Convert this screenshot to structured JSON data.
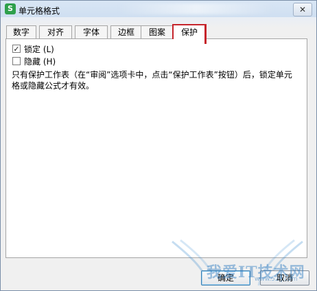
{
  "window": {
    "title": "单元格格式",
    "app_icon_letter": "S",
    "close_glyph": "✕"
  },
  "tabs": [
    {
      "label": "数字",
      "active": false
    },
    {
      "label": "对齐",
      "active": false
    },
    {
      "label": "字体",
      "active": false
    },
    {
      "label": "边框",
      "active": false
    },
    {
      "label": "图案",
      "active": false
    },
    {
      "label": "保护",
      "active": true
    }
  ],
  "protection": {
    "locked": {
      "label": "锁定 (L)",
      "checked": true
    },
    "hidden": {
      "label": "隐藏 (H)",
      "checked": false
    },
    "description": "只有保护工作表（在“审阅”选项卡中，点击“保护工作表”按钮）后，锁定单元格或隐藏公式才有效。"
  },
  "buttons": {
    "ok": "确定",
    "cancel": "取消"
  },
  "watermark": {
    "text": "我爱IT技术网",
    "url": "www.52ij.com"
  },
  "colors": {
    "highlight": "#c6242b",
    "app_icon": "#2ea04c"
  },
  "icons": {
    "app": "wps-spreadsheet-icon",
    "close": "close-icon",
    "check": "checkmark-icon"
  }
}
